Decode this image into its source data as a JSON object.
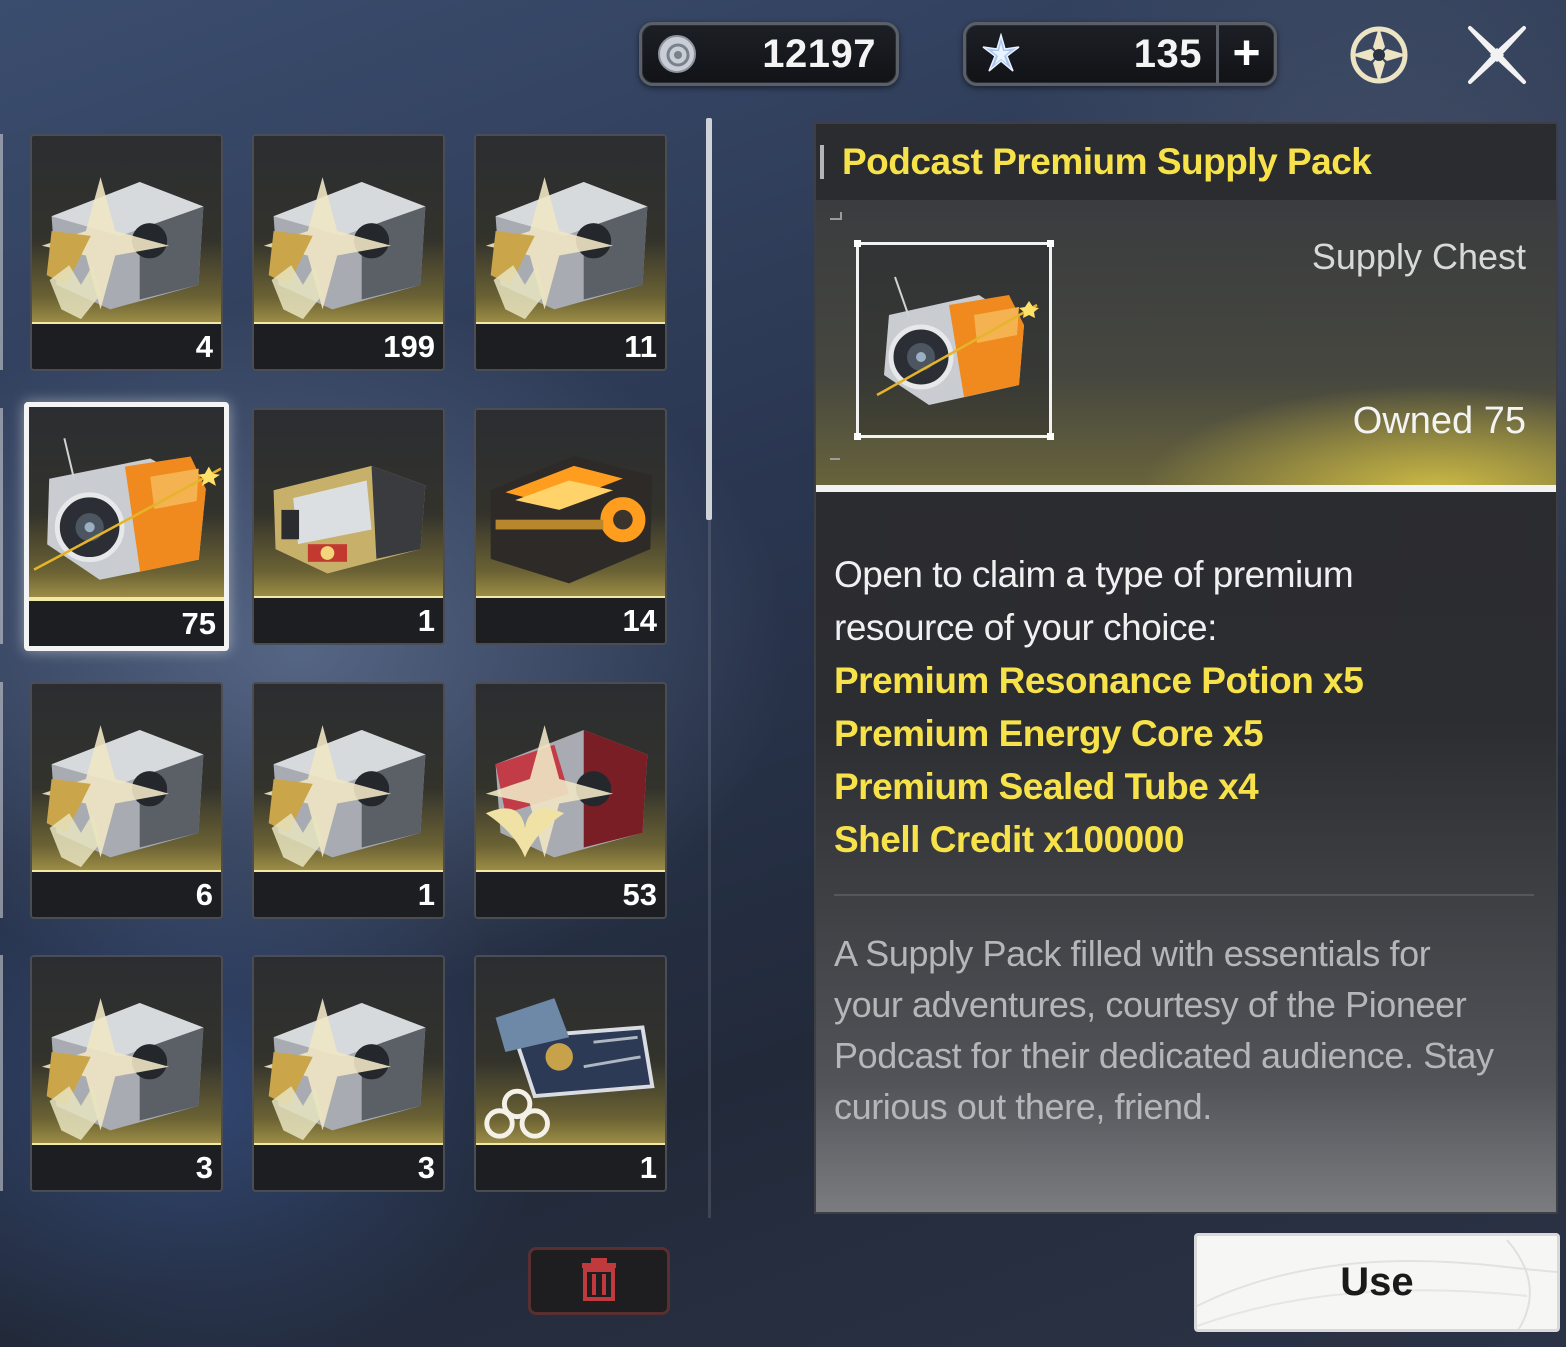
{
  "currencies": {
    "shell_credit": {
      "value": "12197",
      "icon": "shell-credit-icon"
    },
    "astrite": {
      "value": "135",
      "icon": "astrite-star-icon",
      "add_label": "+"
    }
  },
  "toolbar": {
    "settings_icon": "gear-icon",
    "close_icon": "close-icon"
  },
  "inventory": {
    "items": [
      {
        "count": "4",
        "kind": "grey-chest-wolf"
      },
      {
        "count": "199",
        "kind": "grey-chest-wolf"
      },
      {
        "count": "11",
        "kind": "grey-chest-wolf"
      },
      {
        "count": "75",
        "kind": "podcast-pack",
        "selected": true
      },
      {
        "count": "1",
        "kind": "gold-crate"
      },
      {
        "count": "14",
        "kind": "orange-capsule"
      },
      {
        "count": "6",
        "kind": "grey-chest-wolf"
      },
      {
        "count": "1",
        "kind": "grey-chest-wolf"
      },
      {
        "count": "53",
        "kind": "red-chest-emblem"
      },
      {
        "count": "3",
        "kind": "grey-chest-wolf"
      },
      {
        "count": "3",
        "kind": "grey-chest-wolf"
      },
      {
        "count": "1",
        "kind": "ticket-clover"
      }
    ],
    "delete_icon": "trash-icon"
  },
  "detail": {
    "title": "Podcast Premium Supply Pack",
    "type": "Supply Chest",
    "owned": "Owned 75",
    "intro_line1": "Open to claim a type of premium",
    "intro_line2": "resource of your choice:",
    "rewards": [
      "Premium Resonance Potion x5",
      "Premium Energy Core x5",
      "Premium Sealed Tube x4",
      "Shell Credit x100000"
    ],
    "flavor": [
      "A Supply Pack filled with essentials for",
      "your adventures, courtesy of the Pioneer",
      "Podcast for their dedicated audience. Stay",
      "curious out there, friend."
    ]
  },
  "actions": {
    "use_label": "Use"
  },
  "colors": {
    "accent_yellow": "#f7e349",
    "slot_glow": "#f1e9a8",
    "delete_border": "#5a2f31",
    "delete_icon": "#c0393d"
  }
}
